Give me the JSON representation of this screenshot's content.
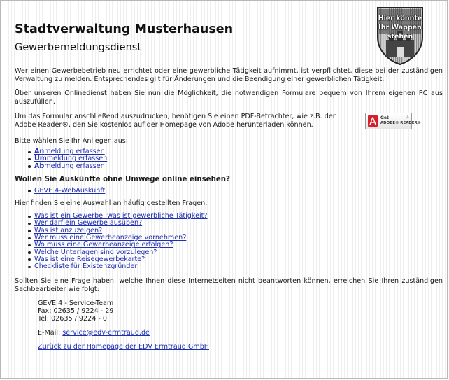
{
  "header": {
    "title": "Stadtverwaltung Musterhausen",
    "subtitle": "Gewerbemeldungsdienst",
    "crest_text_lines": [
      "Hier könnte",
      "Ihr Wappen",
      "stehen"
    ]
  },
  "intro": {
    "paragraph1": "Wer einen Gewerbebetrieb neu errichtet oder eine gewerbliche Tätigkeit aufnimmt, ist verpflichtet, diese bei der zuständigen Verwaltung zu melden. Entsprechendes gilt für Änderungen und die Beendigung einer gewerblichen Tätigkeit.",
    "paragraph2": "Über unseren Onlinedienst haben Sie nun die Möglichkeit, die notwendigen Formulare bequem von Ihrem eigenen PC aus auszufüllen.",
    "pdf_paragraph": "Um das Formular anschließend auszudrucken, benötigen Sie einen PDF-Betrachter, wie z.B. den Adobe Reader®, den Sie kostenlos auf der Homepage von Adobe herunterladen können."
  },
  "adobe_badge": {
    "get": "Get",
    "reader": "ADOBE® READER®"
  },
  "choose_text": "Bitte wählen Sie Ihr Anliegen aus:",
  "actions": [
    {
      "prefix": "An",
      "rest": "meldung erfassen"
    },
    {
      "prefix": "Um",
      "rest": "meldung erfassen"
    },
    {
      "prefix": "Ab",
      "rest": "meldung erfassen"
    }
  ],
  "online_heading": "Wollen Sie Auskünfte ohne Umwege online einsehen?",
  "webauskunft_link": "GEVE 4-WebAuskunft",
  "faq_intro": "Hier finden Sie eine Auswahl an häufig gestellten Fragen.",
  "faq": [
    "Was ist ein Gewerbe, was ist gewerbliche Tätigkeit?",
    "Wer darf ein Gewerbe ausüben?",
    "Was ist anzuzeigen?",
    "Wer muss eine Gewerbeanzeige vornehmen?",
    "Wo muss eine Gewerbeanzeige erfolgen?",
    "Welche Unterlagen sind vorzulegen?",
    "Was ist eine Reisegewerbekarte?",
    "Checkliste für Existenzgründer"
  ],
  "question_text": "Sollten Sie eine Frage haben, welche Ihnen diese Internetseiten nicht beantworten können, erreichen Sie Ihren zuständigen Sachbearbeiter wie folgt:",
  "contact": {
    "team": "GEVE 4 - Service-Team",
    "fax": "Fax: 02635 / 9224 - 29",
    "tel": "Tel: 02635 / 9224 - 0",
    "email_label": "E-Mail: ",
    "email": "service@edv-ermtraud.de"
  },
  "back_link": "Zurück zu der Homepage der EDV Ermtraud GmbH",
  "colors": {
    "link": "#1f2fb0",
    "adobe_red": "#d4202a"
  }
}
